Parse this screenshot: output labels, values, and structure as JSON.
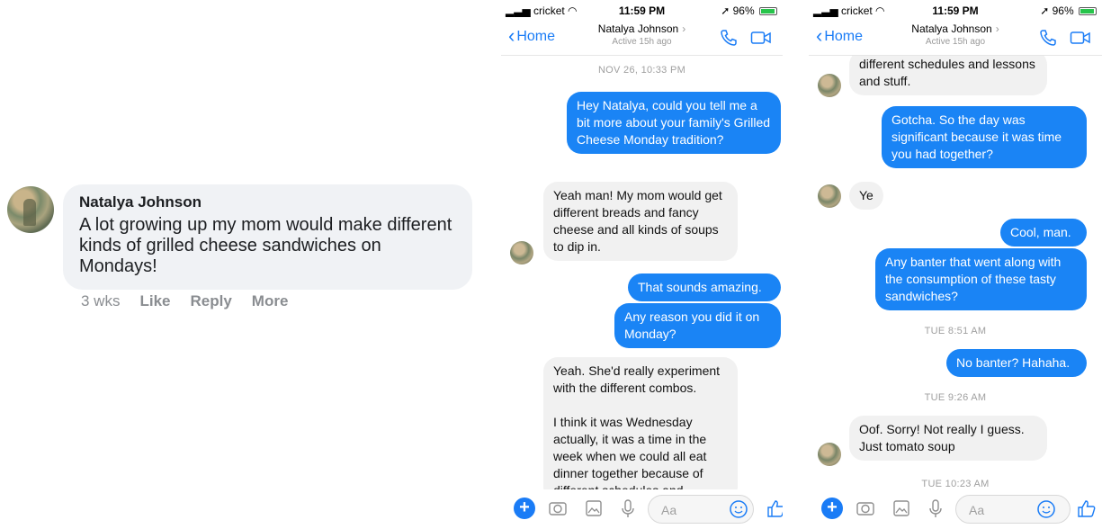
{
  "fb_comment": {
    "name": "Natalya Johnson",
    "text": "A lot growing up my mom would make different kinds of grilled cheese sandwiches on Mondays!",
    "time": "3 wks",
    "like": "Like",
    "reply": "Reply",
    "more": "More"
  },
  "status": {
    "carrier": "cricket",
    "time": "11:59 PM",
    "battery": "96%"
  },
  "header": {
    "back": "Home",
    "contact": "Natalya Johnson",
    "active": "Active 15h ago"
  },
  "composer": {
    "placeholder": "Aa"
  },
  "chat1": {
    "ts1": "NOV 26, 10:33 PM",
    "m1": "Hey Natalya, could you tell me a bit more about your family's Grilled Cheese Monday tradition?",
    "m2": "Yeah man! My mom would get different breads and fancy cheese and all kinds of soups to dip in.",
    "m3": "That sounds amazing.",
    "m4": "Any reason you did it on Monday?",
    "m5a": "Yeah. She'd really experiment with the different combos.",
    "m5b": "I think it was Wednesday actually, it was a time in the week when we could all eat dinner together because of different schedules and"
  },
  "chat2": {
    "m1": "different schedules and lessons and stuff.",
    "m2": "Gotcha. So the day was significant because it was time you had together?",
    "m3": "Ye",
    "m4": "Cool, man.",
    "m5": "Any banter that went along with the consumption of these tasty sandwiches?",
    "ts1": "TUE 8:51 AM",
    "m6": "No banter? Hahaha.",
    "ts2": "TUE 9:26 AM",
    "m7": "Oof. Sorry! Not really I guess. Just tomato soup",
    "ts3": "TUE 10:23 AM"
  },
  "colors": {
    "accent": "#1a84f5",
    "incoming": "#f1f1f1"
  }
}
